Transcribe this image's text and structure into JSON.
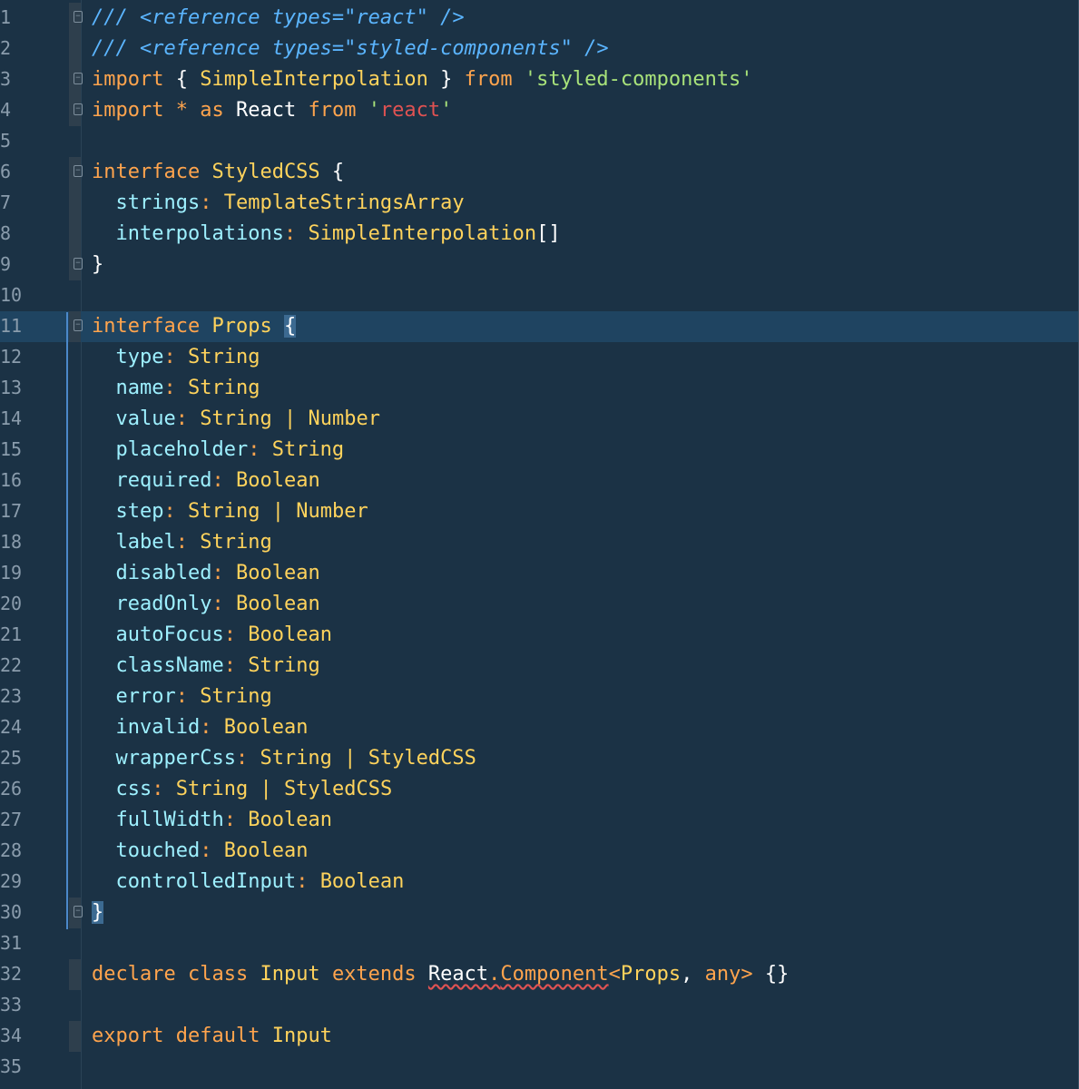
{
  "editor": {
    "lines": [
      {
        "n": "1",
        "fold": "top",
        "tokens": [
          {
            "t": "/// ",
            "c": "#5bb5ff",
            "i": true
          },
          {
            "t": "<reference",
            "c": "#5bb5ff",
            "i": true
          },
          {
            "t": " ",
            "c": "#5bb5ff"
          },
          {
            "t": "types=\"react\"",
            "c": "#5bb5ff",
            "i": true
          },
          {
            "t": " />",
            "c": "#5bb5ff",
            "i": true
          }
        ]
      },
      {
        "n": "2",
        "fold": "bar",
        "tokens": [
          {
            "t": "/// ",
            "c": "#5bb5ff",
            "i": true
          },
          {
            "t": "<reference",
            "c": "#5bb5ff",
            "i": true
          },
          {
            "t": " ",
            "c": "#5bb5ff"
          },
          {
            "t": "types=\"styled-components\"",
            "c": "#5bb5ff",
            "i": true
          },
          {
            "t": " />",
            "c": "#5bb5ff",
            "i": true
          }
        ]
      },
      {
        "n": "3",
        "fold": "top",
        "tokens": [
          {
            "t": "import",
            "c": "#ffa44d"
          },
          {
            "t": " { ",
            "c": "#ffffff"
          },
          {
            "t": "SimpleInterpolation",
            "c": "#ffd35c"
          },
          {
            "t": " } ",
            "c": "#ffffff"
          },
          {
            "t": "from",
            "c": "#ffa44d"
          },
          {
            "t": " ",
            "c": "#ffffff"
          },
          {
            "t": "'styled-components'",
            "c": "#a8e27a"
          }
        ]
      },
      {
        "n": "4",
        "fold": "bottom",
        "tokens": [
          {
            "t": "import",
            "c": "#ffa44d"
          },
          {
            "t": " * ",
            "c": "#ffa44d"
          },
          {
            "t": "as",
            "c": "#ffa44d"
          },
          {
            "t": " React ",
            "c": "#ffffff"
          },
          {
            "t": "from",
            "c": "#ffa44d"
          },
          {
            "t": " ",
            "c": "#ffffff"
          },
          {
            "t": "'",
            "c": "#a8e27a"
          },
          {
            "t": "react",
            "c": "#e05252"
          },
          {
            "t": "'",
            "c": "#a8e27a"
          }
        ]
      },
      {
        "n": "5",
        "fold": "none",
        "tokens": []
      },
      {
        "n": "6",
        "fold": "top",
        "tokens": [
          {
            "t": "interface",
            "c": "#ffa44d"
          },
          {
            "t": " ",
            "c": "#ffffff"
          },
          {
            "t": "StyledCSS",
            "c": "#ffd35c"
          },
          {
            "t": " {",
            "c": "#ffffff"
          }
        ]
      },
      {
        "n": "7",
        "fold": "bar",
        "tokens": [
          {
            "t": "  ",
            "c": "#ffffff"
          },
          {
            "t": "strings",
            "c": "#9ef0ff"
          },
          {
            "t": ": ",
            "c": "#ffa44d"
          },
          {
            "t": "TemplateStringsArray",
            "c": "#ffd35c"
          }
        ]
      },
      {
        "n": "8",
        "fold": "bar",
        "tokens": [
          {
            "t": "  ",
            "c": "#ffffff"
          },
          {
            "t": "interpolations",
            "c": "#9ef0ff"
          },
          {
            "t": ": ",
            "c": "#ffa44d"
          },
          {
            "t": "SimpleInterpolation",
            "c": "#ffd35c"
          },
          {
            "t": "[]",
            "c": "#ffffff"
          }
        ]
      },
      {
        "n": "9",
        "fold": "bottom",
        "tokens": [
          {
            "t": "}",
            "c": "#ffffff"
          }
        ]
      },
      {
        "n": "10",
        "fold": "none",
        "tokens": []
      },
      {
        "n": "11",
        "fold": "top",
        "active": true,
        "tokens": [
          {
            "t": "interface",
            "c": "#ffa44d"
          },
          {
            "t": " ",
            "c": "#ffffff"
          },
          {
            "t": "Props",
            "c": "#ffd35c"
          },
          {
            "t": " ",
            "c": "#ffffff"
          },
          {
            "t": "{",
            "c": "#ffffff",
            "hl": true
          }
        ]
      },
      {
        "n": "12",
        "fold": "none",
        "tokens": [
          {
            "t": "  ",
            "c": "#ffffff"
          },
          {
            "t": "type",
            "c": "#9ef0ff"
          },
          {
            "t": ": ",
            "c": "#ffa44d"
          },
          {
            "t": "String",
            "c": "#ffd35c"
          }
        ]
      },
      {
        "n": "13",
        "fold": "none",
        "tokens": [
          {
            "t": "  ",
            "c": "#ffffff"
          },
          {
            "t": "name",
            "c": "#9ef0ff"
          },
          {
            "t": ": ",
            "c": "#ffa44d"
          },
          {
            "t": "String",
            "c": "#ffd35c"
          }
        ]
      },
      {
        "n": "14",
        "fold": "none",
        "tokens": [
          {
            "t": "  ",
            "c": "#ffffff"
          },
          {
            "t": "value",
            "c": "#9ef0ff"
          },
          {
            "t": ": ",
            "c": "#ffa44d"
          },
          {
            "t": "String",
            "c": "#ffd35c"
          },
          {
            "t": " | ",
            "c": "#ffd35c"
          },
          {
            "t": "Number",
            "c": "#ffd35c"
          }
        ]
      },
      {
        "n": "15",
        "fold": "none",
        "tokens": [
          {
            "t": "  ",
            "c": "#ffffff"
          },
          {
            "t": "placeholder",
            "c": "#9ef0ff"
          },
          {
            "t": ": ",
            "c": "#ffa44d"
          },
          {
            "t": "String",
            "c": "#ffd35c"
          }
        ]
      },
      {
        "n": "16",
        "fold": "none",
        "tokens": [
          {
            "t": "  ",
            "c": "#ffffff"
          },
          {
            "t": "required",
            "c": "#9ef0ff"
          },
          {
            "t": ": ",
            "c": "#ffa44d"
          },
          {
            "t": "Boolean",
            "c": "#ffd35c"
          }
        ]
      },
      {
        "n": "17",
        "fold": "none",
        "tokens": [
          {
            "t": "  ",
            "c": "#ffffff"
          },
          {
            "t": "step",
            "c": "#9ef0ff"
          },
          {
            "t": ": ",
            "c": "#ffa44d"
          },
          {
            "t": "String",
            "c": "#ffd35c"
          },
          {
            "t": " | ",
            "c": "#ffd35c"
          },
          {
            "t": "Number",
            "c": "#ffd35c"
          }
        ]
      },
      {
        "n": "18",
        "fold": "none",
        "tokens": [
          {
            "t": "  ",
            "c": "#ffffff"
          },
          {
            "t": "label",
            "c": "#9ef0ff"
          },
          {
            "t": ": ",
            "c": "#ffa44d"
          },
          {
            "t": "String",
            "c": "#ffd35c"
          }
        ]
      },
      {
        "n": "19",
        "fold": "none",
        "tokens": [
          {
            "t": "  ",
            "c": "#ffffff"
          },
          {
            "t": "disabled",
            "c": "#9ef0ff"
          },
          {
            "t": ": ",
            "c": "#ffa44d"
          },
          {
            "t": "Boolean",
            "c": "#ffd35c"
          }
        ]
      },
      {
        "n": "20",
        "fold": "none",
        "tokens": [
          {
            "t": "  ",
            "c": "#ffffff"
          },
          {
            "t": "readOnly",
            "c": "#9ef0ff"
          },
          {
            "t": ": ",
            "c": "#ffa44d"
          },
          {
            "t": "Boolean",
            "c": "#ffd35c"
          }
        ]
      },
      {
        "n": "21",
        "fold": "none",
        "tokens": [
          {
            "t": "  ",
            "c": "#ffffff"
          },
          {
            "t": "autoFocus",
            "c": "#9ef0ff"
          },
          {
            "t": ": ",
            "c": "#ffa44d"
          },
          {
            "t": "Boolean",
            "c": "#ffd35c"
          }
        ]
      },
      {
        "n": "22",
        "fold": "none",
        "tokens": [
          {
            "t": "  ",
            "c": "#ffffff"
          },
          {
            "t": "className",
            "c": "#9ef0ff"
          },
          {
            "t": ": ",
            "c": "#ffa44d"
          },
          {
            "t": "String",
            "c": "#ffd35c"
          }
        ]
      },
      {
        "n": "23",
        "fold": "none",
        "tokens": [
          {
            "t": "  ",
            "c": "#ffffff"
          },
          {
            "t": "error",
            "c": "#9ef0ff"
          },
          {
            "t": ": ",
            "c": "#ffa44d"
          },
          {
            "t": "String",
            "c": "#ffd35c"
          }
        ]
      },
      {
        "n": "24",
        "fold": "none",
        "tokens": [
          {
            "t": "  ",
            "c": "#ffffff"
          },
          {
            "t": "invalid",
            "c": "#9ef0ff"
          },
          {
            "t": ": ",
            "c": "#ffa44d"
          },
          {
            "t": "Boolean",
            "c": "#ffd35c"
          }
        ]
      },
      {
        "n": "25",
        "fold": "none",
        "tokens": [
          {
            "t": "  ",
            "c": "#ffffff"
          },
          {
            "t": "wrapperCss",
            "c": "#9ef0ff"
          },
          {
            "t": ": ",
            "c": "#ffa44d"
          },
          {
            "t": "String",
            "c": "#ffd35c"
          },
          {
            "t": " | ",
            "c": "#ffd35c"
          },
          {
            "t": "StyledCSS",
            "c": "#ffd35c"
          }
        ]
      },
      {
        "n": "26",
        "fold": "none",
        "tokens": [
          {
            "t": "  ",
            "c": "#ffffff"
          },
          {
            "t": "css",
            "c": "#9ef0ff"
          },
          {
            "t": ": ",
            "c": "#ffa44d"
          },
          {
            "t": "String",
            "c": "#ffd35c"
          },
          {
            "t": " | ",
            "c": "#ffd35c"
          },
          {
            "t": "StyledCSS",
            "c": "#ffd35c"
          }
        ]
      },
      {
        "n": "27",
        "fold": "none",
        "tokens": [
          {
            "t": "  ",
            "c": "#ffffff"
          },
          {
            "t": "fullWidth",
            "c": "#9ef0ff"
          },
          {
            "t": ": ",
            "c": "#ffa44d"
          },
          {
            "t": "Boolean",
            "c": "#ffd35c"
          }
        ]
      },
      {
        "n": "28",
        "fold": "none",
        "tokens": [
          {
            "t": "  ",
            "c": "#ffffff"
          },
          {
            "t": "touched",
            "c": "#9ef0ff"
          },
          {
            "t": ": ",
            "c": "#ffa44d"
          },
          {
            "t": "Boolean",
            "c": "#ffd35c"
          }
        ]
      },
      {
        "n": "29",
        "fold": "none",
        "tokens": [
          {
            "t": "  ",
            "c": "#ffffff"
          },
          {
            "t": "controlledInput",
            "c": "#9ef0ff"
          },
          {
            "t": ": ",
            "c": "#ffa44d"
          },
          {
            "t": "Boolean",
            "c": "#ffd35c"
          }
        ]
      },
      {
        "n": "30",
        "fold": "bottom",
        "tokens": [
          {
            "t": "}",
            "c": "#ffffff",
            "hl": true
          }
        ]
      },
      {
        "n": "31",
        "fold": "none",
        "tokens": []
      },
      {
        "n": "32",
        "fold": "bar",
        "tokens": [
          {
            "t": "declare",
            "c": "#ffa44d"
          },
          {
            "t": " ",
            "c": "#ffffff"
          },
          {
            "t": "class",
            "c": "#ffa44d"
          },
          {
            "t": " ",
            "c": "#ffffff"
          },
          {
            "t": "Input",
            "c": "#ffd35c"
          },
          {
            "t": " ",
            "c": "#ffffff"
          },
          {
            "t": "extends",
            "c": "#ffa44d"
          },
          {
            "t": " ",
            "c": "#ffffff"
          },
          {
            "t": "React",
            "c": "#ffffff",
            "sq": true
          },
          {
            "t": ".",
            "c": "#ffa44d",
            "sq": true
          },
          {
            "t": "Component",
            "c": "#ffa44d",
            "sq": true
          },
          {
            "t": "<",
            "c": "#ffa44d"
          },
          {
            "t": "Props",
            "c": "#ffd35c"
          },
          {
            "t": ", ",
            "c": "#ffffff"
          },
          {
            "t": "any",
            "c": "#ffa44d"
          },
          {
            "t": "> ",
            "c": "#ffa44d"
          },
          {
            "t": "{}",
            "c": "#ffffff"
          }
        ]
      },
      {
        "n": "33",
        "fold": "none",
        "tokens": []
      },
      {
        "n": "34",
        "fold": "bar",
        "tokens": [
          {
            "t": "export",
            "c": "#ffa44d"
          },
          {
            "t": " ",
            "c": "#ffffff"
          },
          {
            "t": "default",
            "c": "#ffa44d"
          },
          {
            "t": " ",
            "c": "#ffffff"
          },
          {
            "t": "Input",
            "c": "#ffd35c"
          }
        ]
      },
      {
        "n": "35",
        "fold": "none",
        "tokens": []
      }
    ]
  }
}
